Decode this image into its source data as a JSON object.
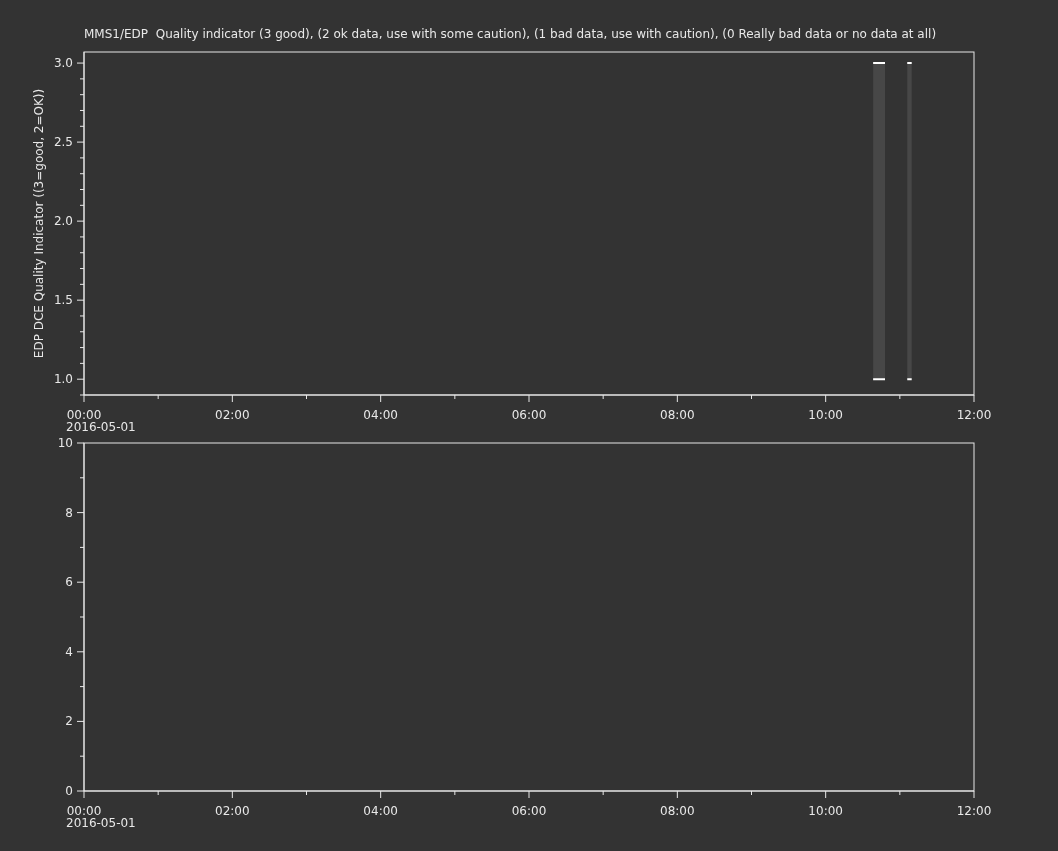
{
  "plots": [
    {
      "date_label": "2016-05-01",
      "chart_data": {
        "type": "line",
        "title": "MMS1/EDP  Quality indicator (3 good), (2 ok data, use with some caution), (1 bad data, use with caution), (0 Really bad data or no data at all)",
        "ylabel": "EDP DCE Quality Indicator ((3=good, 2=OK))",
        "x": [
          10.64,
          10.8,
          10.81,
          11.1,
          11.16
        ],
        "series": [
          {
            "color": "#ffffff",
            "values": [
              3,
              3,
              null,
              3,
              3
            ]
          },
          {
            "color": "#ffffff",
            "values": [
              1,
              1,
              null,
              1,
              1
            ]
          }
        ],
        "xlim": [
          0,
          12
        ],
        "ylim": [
          0.9,
          3.07
        ],
        "xticks": [
          {
            "value": 0,
            "label": "00:00"
          },
          {
            "value": 2,
            "label": "02:00"
          },
          {
            "value": 4,
            "label": "04:00"
          },
          {
            "value": 6,
            "label": "06:00"
          },
          {
            "value": 8,
            "label": "08:00"
          },
          {
            "value": 10,
            "label": "10:00"
          },
          {
            "value": 12,
            "label": "12:00"
          }
        ],
        "yticks": [
          {
            "value": 1,
            "label": "1.0"
          },
          {
            "value": 1.5,
            "label": "1.5"
          },
          {
            "value": 2,
            "label": "2.0"
          },
          {
            "value": 2.5,
            "label": "2.5"
          },
          {
            "value": 3,
            "label": "3.0"
          }
        ]
      }
    },
    {
      "date_label": "2016-05-01",
      "chart_data": {
        "type": "line",
        "xlim": [
          0,
          12
        ],
        "ylim": [
          0,
          10
        ],
        "xticks": [
          {
            "value": 0,
            "label": "00:00"
          },
          {
            "value": 2,
            "label": "02:00"
          },
          {
            "value": 4,
            "label": "04:00"
          },
          {
            "value": 6,
            "label": "06:00"
          },
          {
            "value": 8,
            "label": "08:00"
          },
          {
            "value": 10,
            "label": "10:00"
          },
          {
            "value": 12,
            "label": "12:00"
          }
        ],
        "yticks": [
          {
            "value": 0,
            "label": "0"
          },
          {
            "value": 2,
            "label": "2"
          },
          {
            "value": 4,
            "label": "4"
          },
          {
            "value": 6,
            "label": "6"
          },
          {
            "value": 8,
            "label": "8"
          },
          {
            "value": 10,
            "label": "10"
          }
        ]
      }
    }
  ]
}
